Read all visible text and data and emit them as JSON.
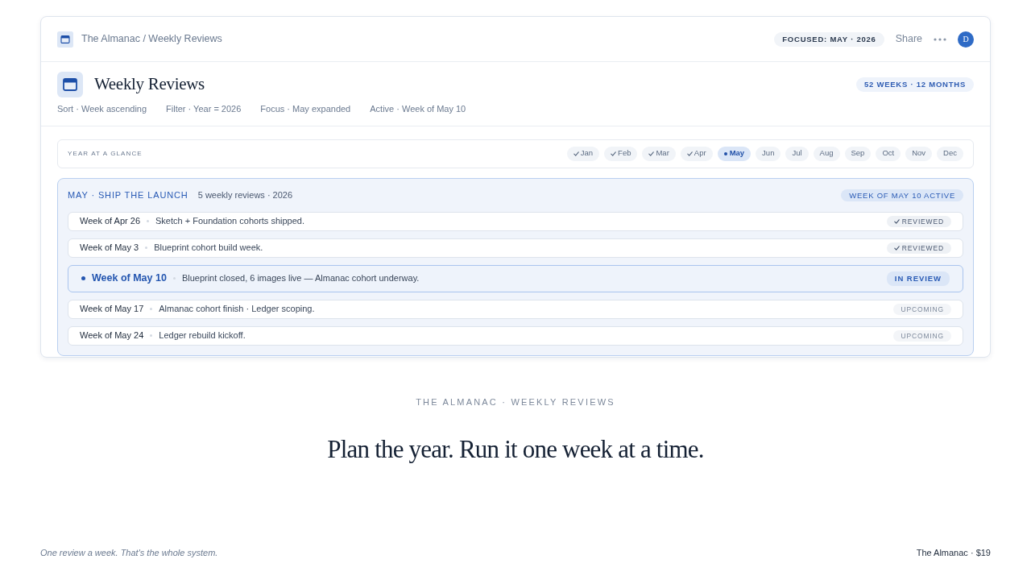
{
  "topbar": {
    "breadcrumb": "The Almanac / Weekly Reviews",
    "focus_badge": "FOCUSED: MAY · 2026",
    "share": "Share",
    "avatar": "D"
  },
  "header": {
    "title": "Weekly Reviews",
    "count_badge": "52 WEEKS · 12 MONTHS",
    "meta": [
      "Sort · Week ascending",
      "Filter · Year = 2026",
      "Focus · May expanded",
      "Active · Week of May 10"
    ]
  },
  "year_glance": {
    "label": "YEAR AT A GLANCE",
    "months": [
      {
        "label": "Jan",
        "kind": "done",
        "selected": false
      },
      {
        "label": "Feb",
        "kind": "done",
        "selected": false
      },
      {
        "label": "Mar",
        "kind": "done",
        "selected": false
      },
      {
        "label": "Apr",
        "kind": "done",
        "selected": false
      },
      {
        "label": "May",
        "kind": "current",
        "selected": true
      },
      {
        "label": "Jun",
        "kind": "upcoming",
        "selected": false
      },
      {
        "label": "Jul",
        "kind": "upcoming",
        "selected": false
      },
      {
        "label": "Aug",
        "kind": "upcoming",
        "selected": false
      },
      {
        "label": "Sep",
        "kind": "upcoming",
        "selected": false
      },
      {
        "label": "Oct",
        "kind": "upcoming",
        "selected": false
      },
      {
        "label": "Nov",
        "kind": "upcoming",
        "selected": false
      },
      {
        "label": "Dec",
        "kind": "upcoming",
        "selected": false
      }
    ]
  },
  "month_panel": {
    "title": "MAY · SHIP THE LAUNCH",
    "subtitle": "5 weekly reviews · 2026",
    "active_badge": "WEEK OF MAY 10 ACTIVE",
    "weeks": [
      {
        "label": "Week of Apr 26",
        "note": "Sketch + Foundation cohorts shipped.",
        "kind": "reviewed",
        "badge": "REVIEWED",
        "selected": false
      },
      {
        "label": "Week of May 3",
        "note": "Blueprint cohort build week.",
        "kind": "reviewed",
        "badge": "REVIEWED",
        "selected": false
      },
      {
        "label": "Week of May 10",
        "note": "Blueprint closed, 6 images live — Almanac cohort underway.",
        "kind": "in_review",
        "badge": "IN REVIEW",
        "selected": true
      },
      {
        "label": "Week of May 17",
        "note": "Almanac cohort finish · Ledger scoping.",
        "kind": "upcoming",
        "badge": "UPCOMING",
        "selected": false
      },
      {
        "label": "Week of May 24",
        "note": "Ledger rebuild kickoff.",
        "kind": "upcoming",
        "badge": "UPCOMING",
        "selected": false
      }
    ]
  },
  "tagline": "THE ALMANAC · WEEKLY REVIEWS",
  "headline": "Plan the year. Run it one week at a time.",
  "footer": {
    "note": "One review a week. That's the whole system.",
    "product": "The Almanac · $19"
  }
}
